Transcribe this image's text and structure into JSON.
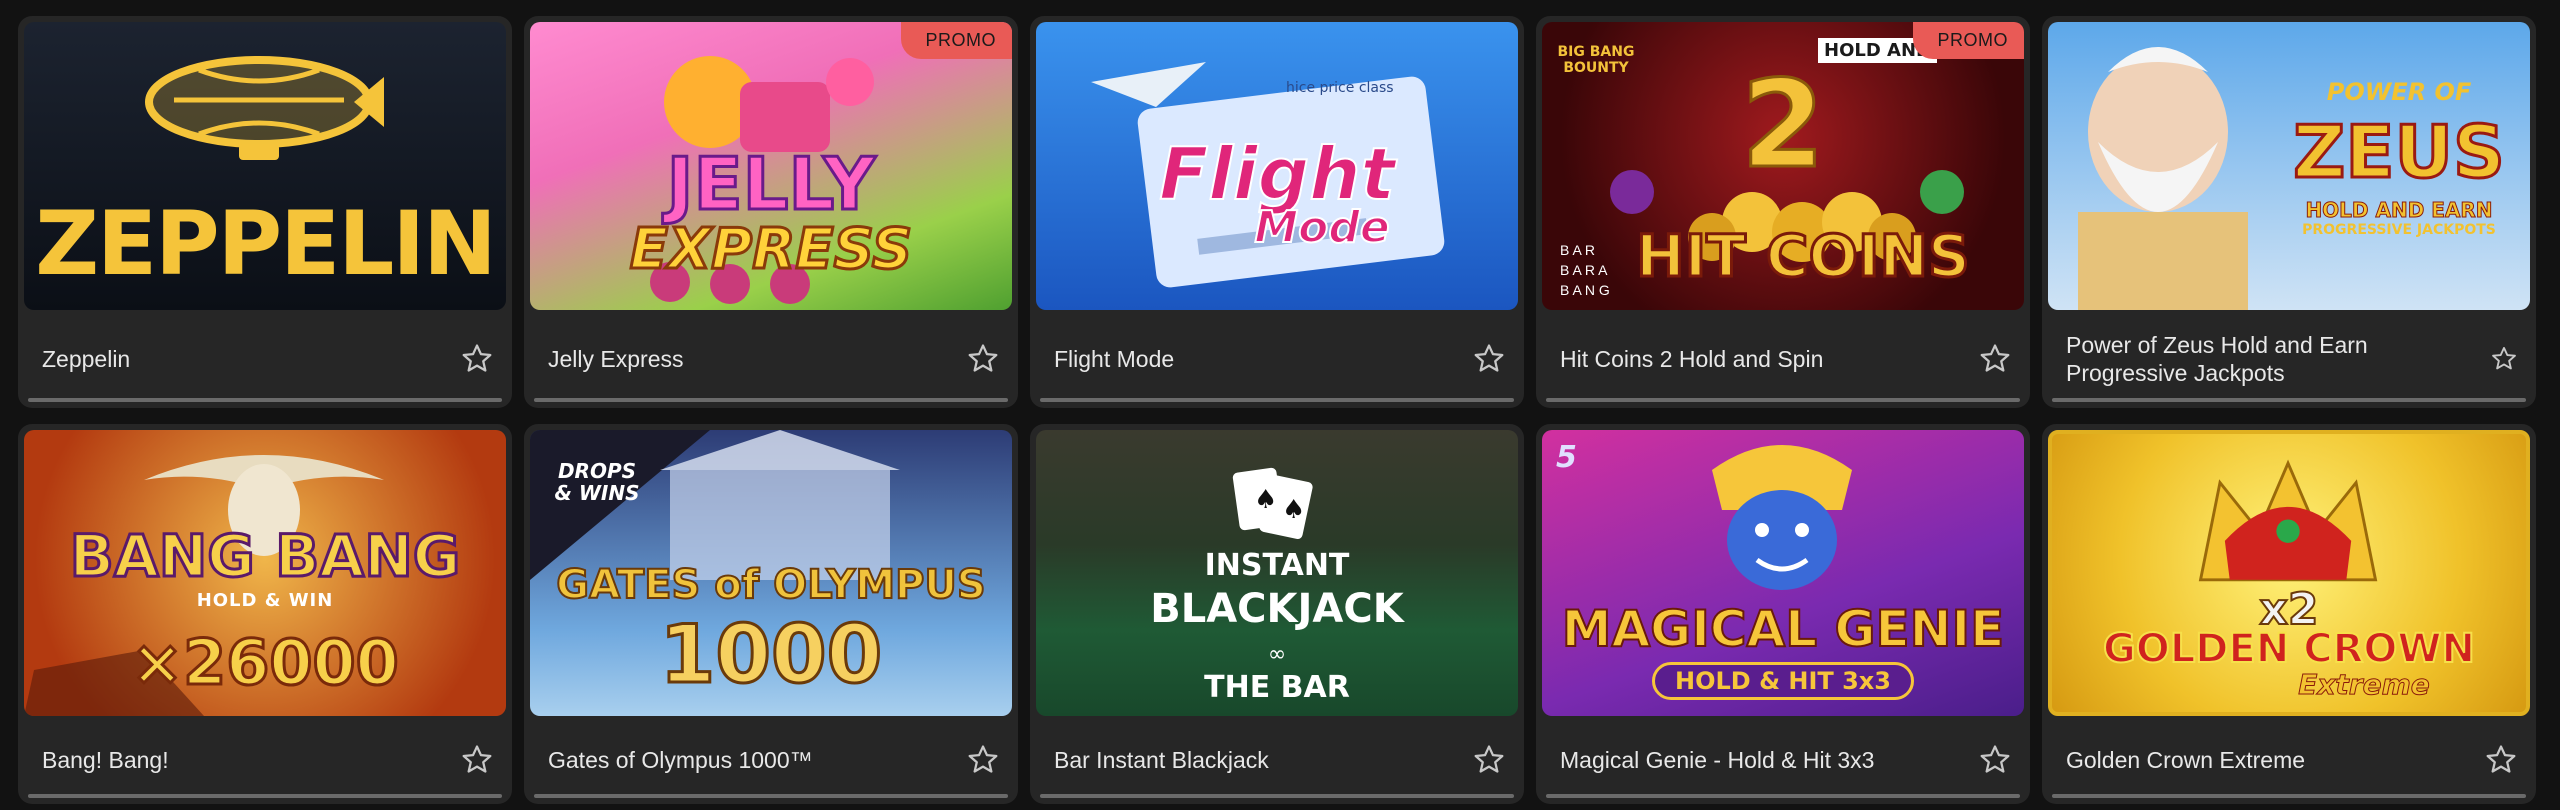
{
  "games": [
    {
      "title": "Zeppelin",
      "logo": "ZEPPELIN",
      "promo": "",
      "favorite": false,
      "colors": {
        "bg_top": "#1c2330",
        "bg_bottom": "#0b0f16",
        "accent": "#f5c43a"
      }
    },
    {
      "title": "Jelly Express",
      "logo_line1": "JELLY",
      "logo_line2": "EXPRESS",
      "promo": "PROMO",
      "favorite": false,
      "colors": {
        "bg_top": "#ff7ac8",
        "bg_bottom": "#6bbf3d",
        "accent": "#ffd23a"
      }
    },
    {
      "title": "Flight Mode",
      "logo_line1": "Flight",
      "logo_line2": "Mode",
      "ticket_text": "hice price class",
      "promo": "",
      "favorite": false,
      "colors": {
        "bg_top": "#2a7fe0",
        "bg_bottom": "#1b4fb8",
        "accent": "#e0267a"
      }
    },
    {
      "title": "Hit Coins 2 Hold and Spin",
      "logo": "HIT COINS",
      "big_number": "2",
      "badge": "BIG BANG BOUNTY",
      "hold_text": "HOLD AND",
      "brand_lines": [
        "B A R",
        "B A R A",
        "B A N G"
      ],
      "promo": "PROMO",
      "favorite": false,
      "colors": {
        "bg_top": "#7a0d12",
        "bg_bottom": "#2a0405",
        "accent": "#f3c23a"
      }
    },
    {
      "title": "Power of Zeus Hold and Earn Progressive Jackpots",
      "logo_line1": "POWER OF",
      "logo_line2": "ZEUS",
      "logo_line3": "HOLD AND EARN",
      "logo_line4": "PROGRESSIVE JACKPOTS",
      "promo": "",
      "favorite": false,
      "colors": {
        "bg_top": "#6fb7f0",
        "bg_bottom": "#dfeefa",
        "accent": "#f2c230"
      }
    },
    {
      "title": "Bang! Bang!",
      "logo": "BANG BANG",
      "subtitle": "HOLD & WIN",
      "multiplier": "×26000",
      "promo": "",
      "favorite": false,
      "colors": {
        "bg_top": "#e8a13a",
        "bg_bottom": "#a3330f",
        "accent": "#f7d04a"
      }
    },
    {
      "title": "Gates of Olympus 1000™",
      "logo_line1": "GATES of OLYMPUS",
      "logo_line2": "1000",
      "badge": "DROPS & WINS",
      "promo": "",
      "favorite": false,
      "colors": {
        "bg_top": "#3a4f8f",
        "bg_bottom": "#7db7e8",
        "accent": "#f0c33c"
      }
    },
    {
      "title": "Bar Instant Blackjack",
      "logo_line1": "INSTANT",
      "logo_line2": "BLACKJACK",
      "logo_line3": "THE BAR",
      "promo": "",
      "favorite": false,
      "colors": {
        "bg_top": "#2f3a2e",
        "bg_bottom": "#1f5a35",
        "accent": "#ffffff"
      }
    },
    {
      "title": "Magical Genie - Hold & Hit 3x3",
      "logo_line1": "MAGICAL GENIE",
      "logo_line2": "HOLD & HIT 3x3",
      "corner_number": "5",
      "promo": "",
      "favorite": false,
      "colors": {
        "bg_top": "#c12a9a",
        "bg_bottom": "#5a1e8e",
        "accent": "#f6c63a"
      }
    },
    {
      "title": "Golden Crown Extreme",
      "logo_line1": "x2",
      "logo_line2": "GOLDEN CROWN",
      "logo_line3": "Extreme",
      "promo": "",
      "favorite": false,
      "colors": {
        "bg_top": "#f7e04a",
        "bg_bottom": "#e0a51a",
        "accent": "#d0231e"
      }
    }
  ]
}
